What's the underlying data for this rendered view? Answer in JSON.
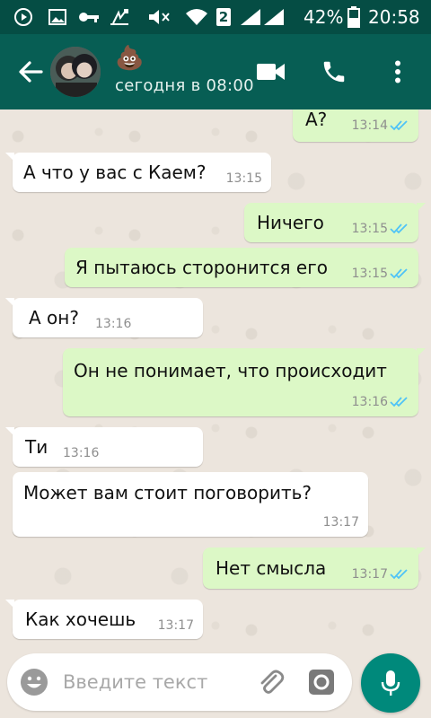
{
  "status_bar": {
    "battery_percent": "42%",
    "time": "20:58",
    "sim_label": "2",
    "icons": [
      "play-icon",
      "image-icon",
      "key-icon",
      "usb-icon",
      "mute-icon",
      "wifi-icon",
      "sim-icon",
      "signal-icon",
      "battery-icon"
    ]
  },
  "header": {
    "contact_name": "💩",
    "status": "сегодня в 08:00"
  },
  "messages": [
    {
      "dir": "out",
      "text": "А?",
      "time": "13:14"
    },
    {
      "dir": "in",
      "text": "А что у вас с Каем?",
      "time": "13:15"
    },
    {
      "dir": "out",
      "text": "Ничего",
      "time": "13:15"
    },
    {
      "dir": "out",
      "text": "Я пытаюсь сторонится его",
      "time": "13:15"
    },
    {
      "dir": "in",
      "text": "А он?",
      "time": "13:16"
    },
    {
      "dir": "out",
      "text": "Он не понимает, что происходит",
      "time": "13:16"
    },
    {
      "dir": "in",
      "text": "Ти",
      "time": "13:16"
    },
    {
      "dir": "in",
      "text": "Может вам стоит поговорить?",
      "time": "13:17"
    },
    {
      "dir": "out",
      "text": "Нет смысла",
      "time": "13:17"
    },
    {
      "dir": "in",
      "text": "Как хочешь",
      "time": "13:17"
    }
  ],
  "input": {
    "placeholder": "Введите текст",
    "value": ""
  },
  "colors": {
    "header": "#075e54",
    "status_bar": "#054d44",
    "outgoing_bubble": "#dcf8c6",
    "incoming_bubble": "#ffffff",
    "read_ticks": "#4fc3f7",
    "mic_button": "#00897b"
  }
}
